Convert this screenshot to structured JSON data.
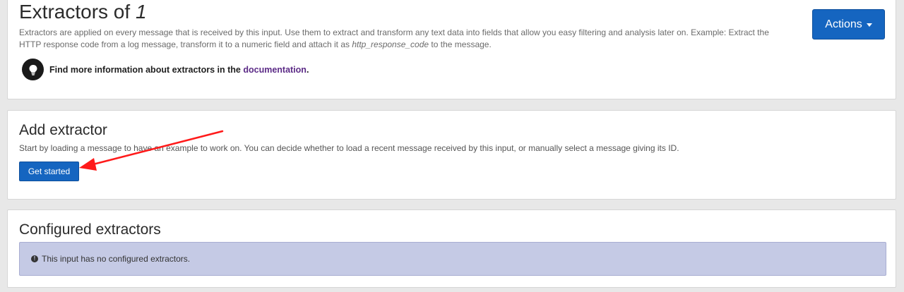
{
  "header": {
    "title_prefix": "Extractors of ",
    "title_number": "1",
    "actions_label": "Actions",
    "description_part1": "Extractors are applied on every message that is received by this input. Use them to extract and transform any text data into fields that allow you easy filtering and analysis later on. Example: Extract the HTTP response code from a log message, transform it to a numeric field and attach it as ",
    "description_code": "http_response_code",
    "description_part2": " to the message.",
    "doc_prefix": "Find more information about extractors in the ",
    "doc_link": "documentation",
    "doc_suffix": "."
  },
  "add_extractor": {
    "title": "Add extractor",
    "description": "Start by loading a message to have an example to work on. You can decide whether to load a recent message received by this input, or manually select a message giving its ID.",
    "button_label": "Get started"
  },
  "configured": {
    "title": "Configured extractors",
    "info_text": "This input has no configured extractors."
  },
  "icons": {
    "actions_caret": "caret-down-icon",
    "doc": "lightbulb-icon",
    "info": "info-circle-icon",
    "annotation": "red-arrow"
  },
  "colors": {
    "primary_button": "#1565c0",
    "link": "#5b2a86",
    "info_box": "#c5cae5",
    "annotation_arrow": "#ff1a1a"
  }
}
